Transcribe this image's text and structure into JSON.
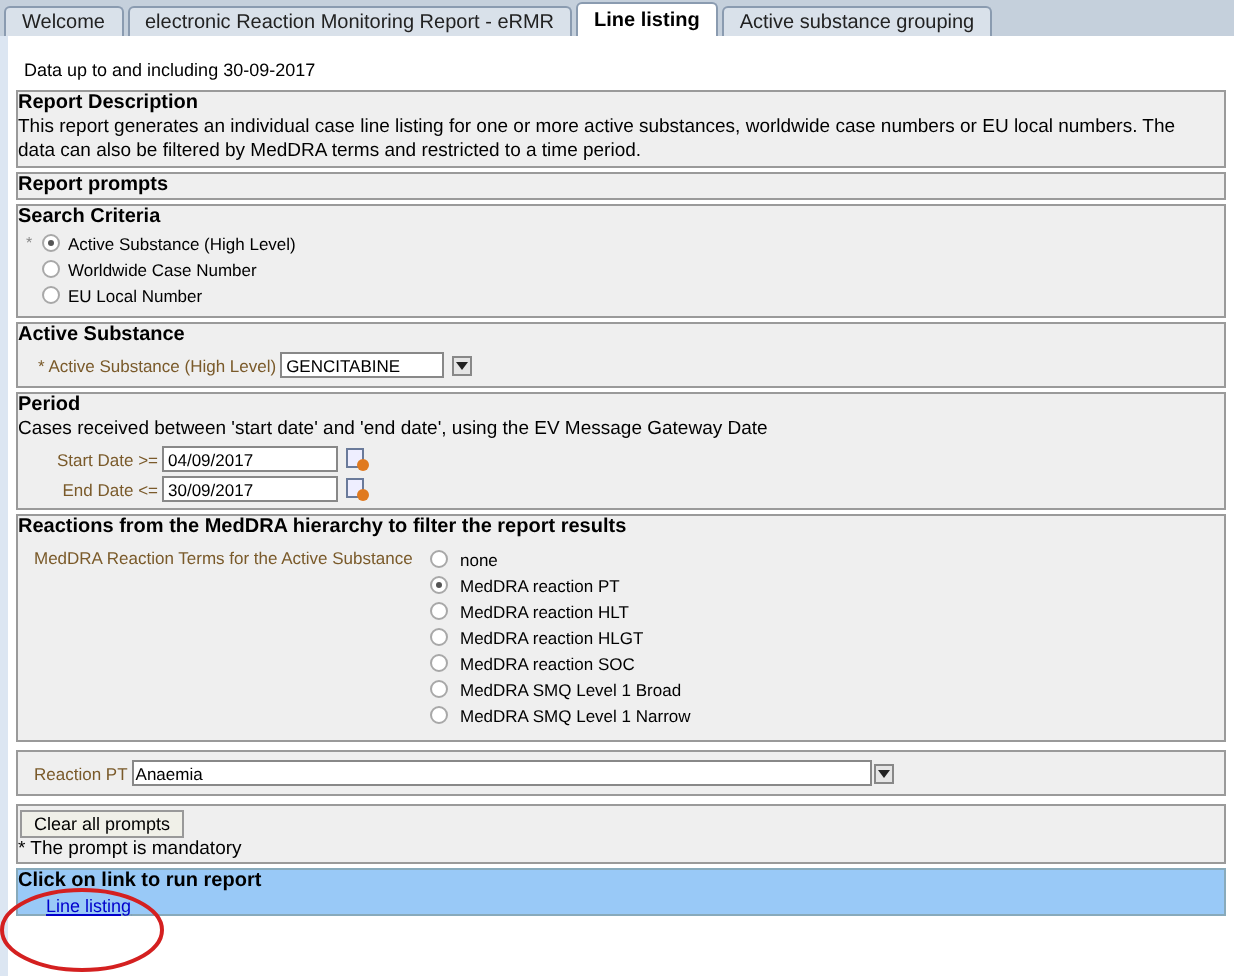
{
  "tabs": [
    {
      "label": "Welcome",
      "selected": false
    },
    {
      "label": "electronic Reaction Monitoring Report - eRMR",
      "selected": false
    },
    {
      "label": "Line listing",
      "selected": true
    },
    {
      "label": "Active substance grouping",
      "selected": false
    }
  ],
  "data_note": "Data up to and including 30-09-2017",
  "report_description": {
    "title": "Report Description",
    "text": "This report generates an individual case line listing for one or more active substances, worldwide case numbers or EU local numbers. The data can also be filtered by MedDRA terms and restricted to a time period."
  },
  "report_prompts": {
    "title": "Report prompts"
  },
  "search_criteria": {
    "title": "Search Criteria",
    "mandatory_mark": "*",
    "options": [
      {
        "label": "Active Substance (High Level)",
        "selected": true
      },
      {
        "label": "Worldwide Case Number",
        "selected": false
      },
      {
        "label": "EU Local Number",
        "selected": false
      }
    ]
  },
  "active_substance": {
    "title": "Active Substance",
    "label": "* Active Substance (High Level)",
    "value": "GENCITABINE"
  },
  "period": {
    "title": "Period",
    "text": "Cases received between 'start date' and 'end date', using the EV Message Gateway Date",
    "fields": [
      {
        "label": "Start Date >=",
        "value": "04/09/2017"
      },
      {
        "label": "End Date <=",
        "value": "30/09/2017"
      }
    ]
  },
  "reactions": {
    "title": "Reactions from the MedDRA hierarchy to filter the report results",
    "label": "MedDRA Reaction Terms for the Active Substance",
    "options": [
      {
        "label": "none",
        "selected": false
      },
      {
        "label": "MedDRA reaction PT",
        "selected": true
      },
      {
        "label": "MedDRA reaction HLT",
        "selected": false
      },
      {
        "label": "MedDRA reaction HLGT",
        "selected": false
      },
      {
        "label": "MedDRA reaction SOC",
        "selected": false
      },
      {
        "label": "MedDRA SMQ Level 1 Broad",
        "selected": false
      },
      {
        "label": "MedDRA SMQ Level 1 Narrow",
        "selected": false
      }
    ]
  },
  "reaction_pt": {
    "label": "Reaction PT",
    "value": "Anaemia"
  },
  "clear_button": "Clear all prompts",
  "mandatory_note": "* The prompt is mandatory",
  "run": {
    "title": "Click on link to run report",
    "link": "Line listing"
  }
}
